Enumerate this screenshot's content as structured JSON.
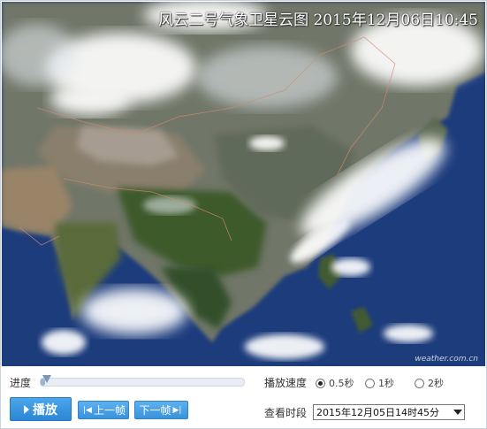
{
  "image": {
    "title": "风云二号气象卫星云图 2015年12月06日10:45",
    "watermark": "weather.com.cn"
  },
  "controls": {
    "progress_label": "进度",
    "progress_value": 0.02,
    "speed_label": "播放速度",
    "speed_options": [
      "0.5秒",
      "1秒",
      "2秒"
    ],
    "speed_selected": "0.5秒",
    "play_label": "播放",
    "prev_label": "上一帧",
    "next_label": "下一帧",
    "time_label": "查看时段",
    "time_value": "2015年12月05日14时45分"
  },
  "colors": {
    "button_blue": "#2b86d5",
    "ocean": "#1c3a78"
  }
}
